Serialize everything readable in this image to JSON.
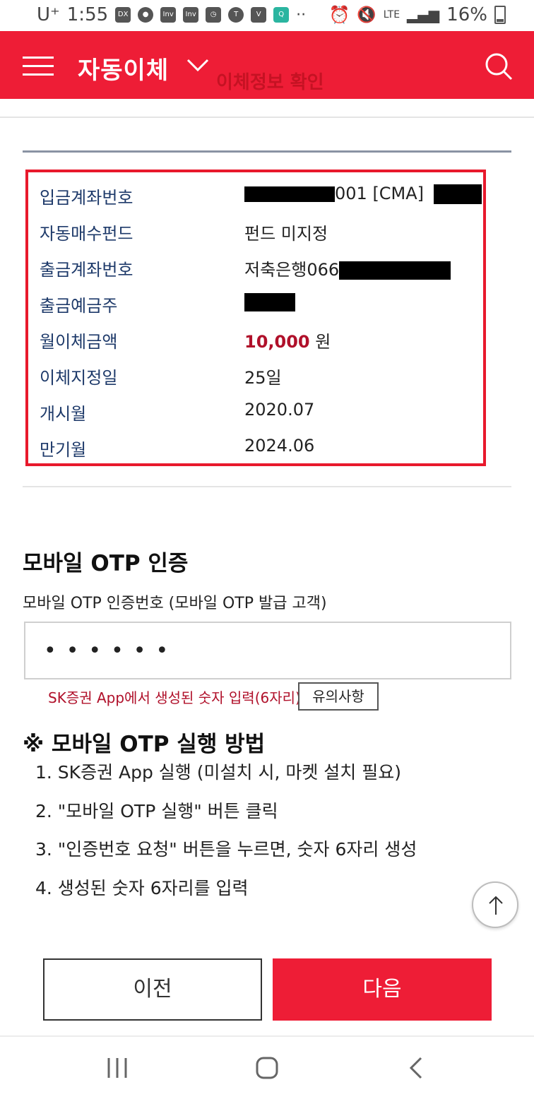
{
  "status_bar": {
    "carrier": "U⁺",
    "time": "1:55",
    "app_icons": [
      "dx-icon",
      "pin-icon",
      "inv-icon",
      "inv-icon",
      "clock-icon",
      "talk-icon",
      "vpn-icon",
      "app-icon",
      "more-dots"
    ],
    "network": "LTE",
    "battery": "16%"
  },
  "header": {
    "title": "자동이체",
    "ghost_text": "이체정보 확인",
    "bg_color": "#ee1d36"
  },
  "info": {
    "rows": [
      {
        "label": "입금계좌번호",
        "value_suffix": "001 [CMA]"
      },
      {
        "label": "자동매수펀드",
        "value": "펀드 미지정"
      },
      {
        "label": "출금계좌번호",
        "value_prefix": "저축은행066"
      },
      {
        "label": "출금예금주"
      },
      {
        "label": "월이체금액",
        "amount": "10,000",
        "unit": "원"
      },
      {
        "label": "이체지정일",
        "value": "25일"
      },
      {
        "label": "개시월",
        "value": "2020.07"
      },
      {
        "label": "만기월",
        "value": "2024.06"
      }
    ]
  },
  "otp": {
    "title": "모바일 OTP 인증",
    "subtitle": "모바일 OTP 인증번호 (모바일 OTP 발급 고객)",
    "input_value": "••••••",
    "hint": "SK증권 App에서 생성된 숫자 입력(6자리)",
    "caution_label": "유의사항"
  },
  "method": {
    "title": "※ 모바일 OTP 실행 방법",
    "steps": [
      "1. SK증권 App 실행 (미설치 시, 마켓 설치 필요)",
      "2. \"모바일 OTP 실행\" 버튼 클릭",
      "3. \"인증번호 요청\" 버튼을 누르면, 숫자 6자리 생성",
      "4. 생성된 숫자 6자리를 입력"
    ]
  },
  "buttons": {
    "prev_label": "이전",
    "next_label": "다음"
  }
}
